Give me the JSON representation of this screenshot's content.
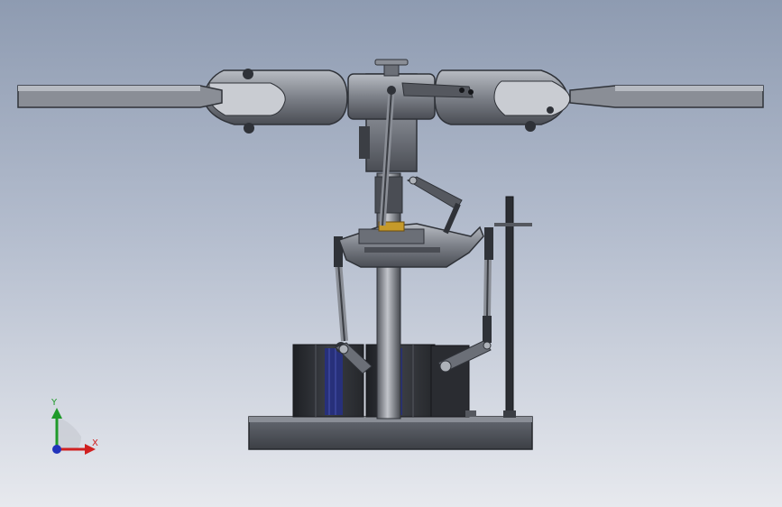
{
  "triad": {
    "x_label": "X",
    "y_label": "Y",
    "x_color": "#d02020",
    "y_color": "#1f9a2a",
    "z_color": "#2233bb"
  },
  "colors": {
    "background_top": "#8e9bb1",
    "background_bottom": "#e7e9ee",
    "part_dark": "#2f3238",
    "part_mid": "#6b6f77",
    "part_light": "#a9adb4",
    "servo_blue": "#27307a",
    "bearing_gold": "#c69a2a"
  }
}
